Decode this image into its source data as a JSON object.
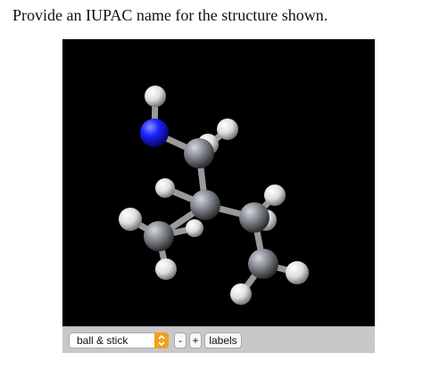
{
  "question": {
    "text": "Provide an IUPAC name for the structure shown."
  },
  "viewer": {
    "colors": {
      "background": "#000000",
      "carbon": "#8a8e94",
      "nitrogen": "#1a22ff",
      "hydrogen": "#e6e6e6",
      "bond": "#9a9a9a"
    }
  },
  "controls": {
    "display_mode": "ball & stick",
    "minus_label": "-",
    "plus_label": "+",
    "labels_label": "labels"
  }
}
